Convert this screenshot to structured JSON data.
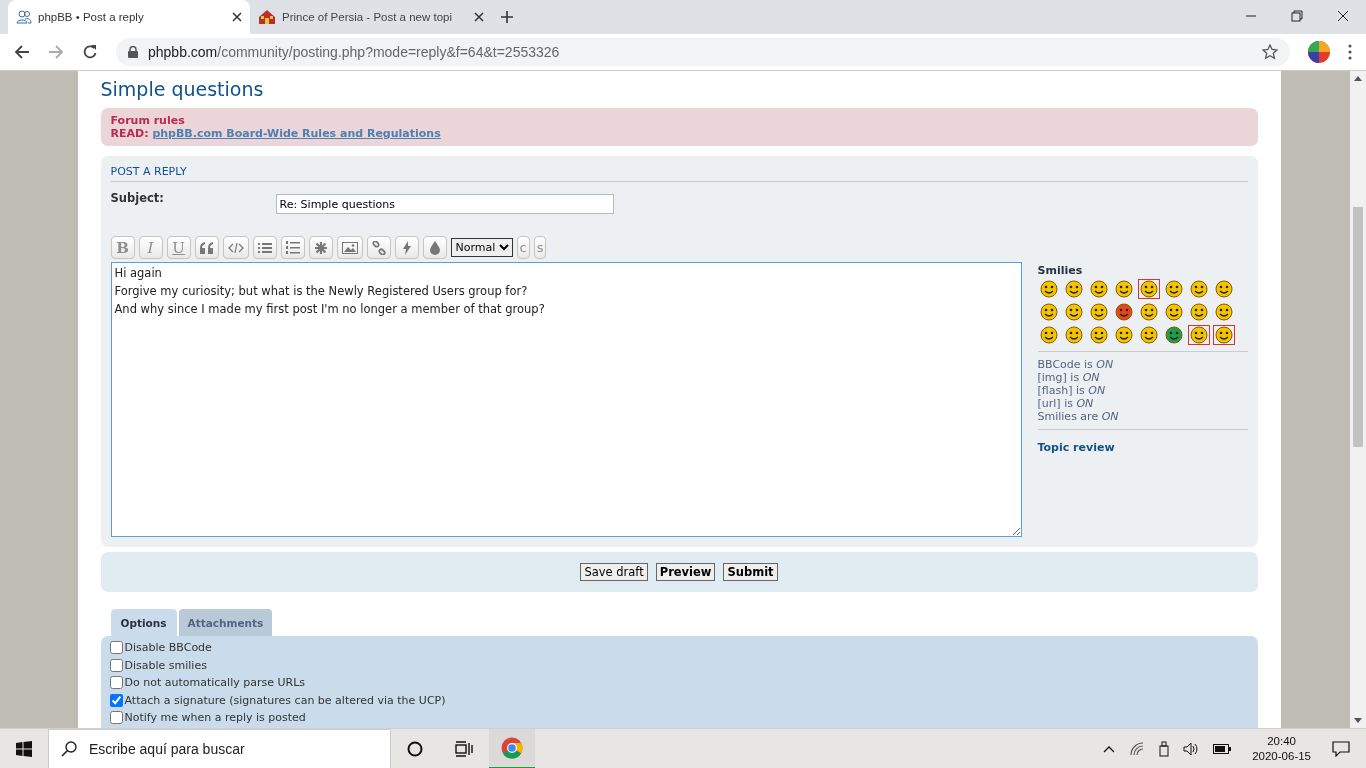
{
  "browser": {
    "tabs": [
      {
        "title": "phpBB • Post a reply",
        "selected": true
      },
      {
        "title": "Prince of Persia - Post a new topi",
        "selected": false
      }
    ],
    "url_host": "phpbb.com",
    "url_path": "/community/posting.php?mode=reply&f=64&t=2553326"
  },
  "page": {
    "title": "Simple questions",
    "rules": {
      "heading": "Forum rules",
      "read_label": "READ:",
      "link": "phpBB.com Board-Wide Rules and Regulations"
    },
    "post": {
      "heading": "POST A REPLY",
      "subject_label": "Subject:",
      "subject_value": "Re: Simple questions",
      "toolbar": {
        "text_buttons_left": [
          "B",
          "I",
          "U"
        ],
        "font_size": "Normal",
        "text_buttons_right": [
          "c",
          "s"
        ]
      },
      "message_lines": [
        "Hi again",
        "Forgive my curiosity; but what is the Newly Registered Users group for?",
        "And why since I made my first post I'm no longer a member of that group?"
      ],
      "smilies_heading": "Smilies",
      "smilies": [
        {
          "color": "#f5c400",
          "highlighted": false
        },
        {
          "color": "#f5c400",
          "highlighted": false
        },
        {
          "color": "#f5c400",
          "highlighted": false
        },
        {
          "color": "#f5c400",
          "highlighted": false
        },
        {
          "color": "#f5c400",
          "highlighted": true
        },
        {
          "color": "#f5c400",
          "highlighted": false
        },
        {
          "color": "#f5c400",
          "highlighted": false
        },
        {
          "color": "#f5c400",
          "highlighted": false
        },
        {
          "color": "#f5c400",
          "highlighted": false
        },
        {
          "color": "#f5c400",
          "highlighted": false
        },
        {
          "color": "#f5c400",
          "highlighted": false
        },
        {
          "color": "#e8461a",
          "highlighted": false
        },
        {
          "color": "#f5c400",
          "highlighted": false
        },
        {
          "color": "#f5c400",
          "highlighted": false
        },
        {
          "color": "#f5c400",
          "highlighted": false
        },
        {
          "color": "#f5c400",
          "highlighted": false
        },
        {
          "color": "#f5c400",
          "highlighted": false
        },
        {
          "color": "#f5c400",
          "highlighted": false
        },
        {
          "color": "#f5c400",
          "highlighted": false
        },
        {
          "color": "#f5c400",
          "highlighted": false
        },
        {
          "color": "#f5c400",
          "highlighted": false
        },
        {
          "color": "#1e9e4a",
          "highlighted": false
        },
        {
          "color": "#f5c400",
          "highlighted": true
        },
        {
          "color": "#f5c400",
          "highlighted": true
        }
      ],
      "status_lines": [
        "BBCode is *ON*",
        "[img] is *ON*",
        "[flash] is *ON*",
        "[url] is *ON*",
        "Smilies are *ON*"
      ],
      "topic_review": "Topic review"
    },
    "actions": [
      {
        "label": "Save draft",
        "primary": false
      },
      {
        "label": "Preview",
        "primary": true
      },
      {
        "label": "Submit",
        "primary": true
      }
    ],
    "option_tabs": [
      {
        "label": "Options",
        "selected": true
      },
      {
        "label": "Attachments",
        "selected": false
      }
    ],
    "options": [
      {
        "label": "Disable BBCode",
        "checked": false
      },
      {
        "label": "Disable smilies",
        "checked": false
      },
      {
        "label": "Do not automatically parse URLs",
        "checked": false
      },
      {
        "label": "Attach a signature (signatures can be altered via the UCP)",
        "checked": true
      },
      {
        "label": "Notify me when a reply is posted",
        "checked": false
      }
    ]
  },
  "taskbar": {
    "search_placeholder": "Escribe aquí para buscar",
    "time": "20:40",
    "date": "2020-06-15"
  }
}
